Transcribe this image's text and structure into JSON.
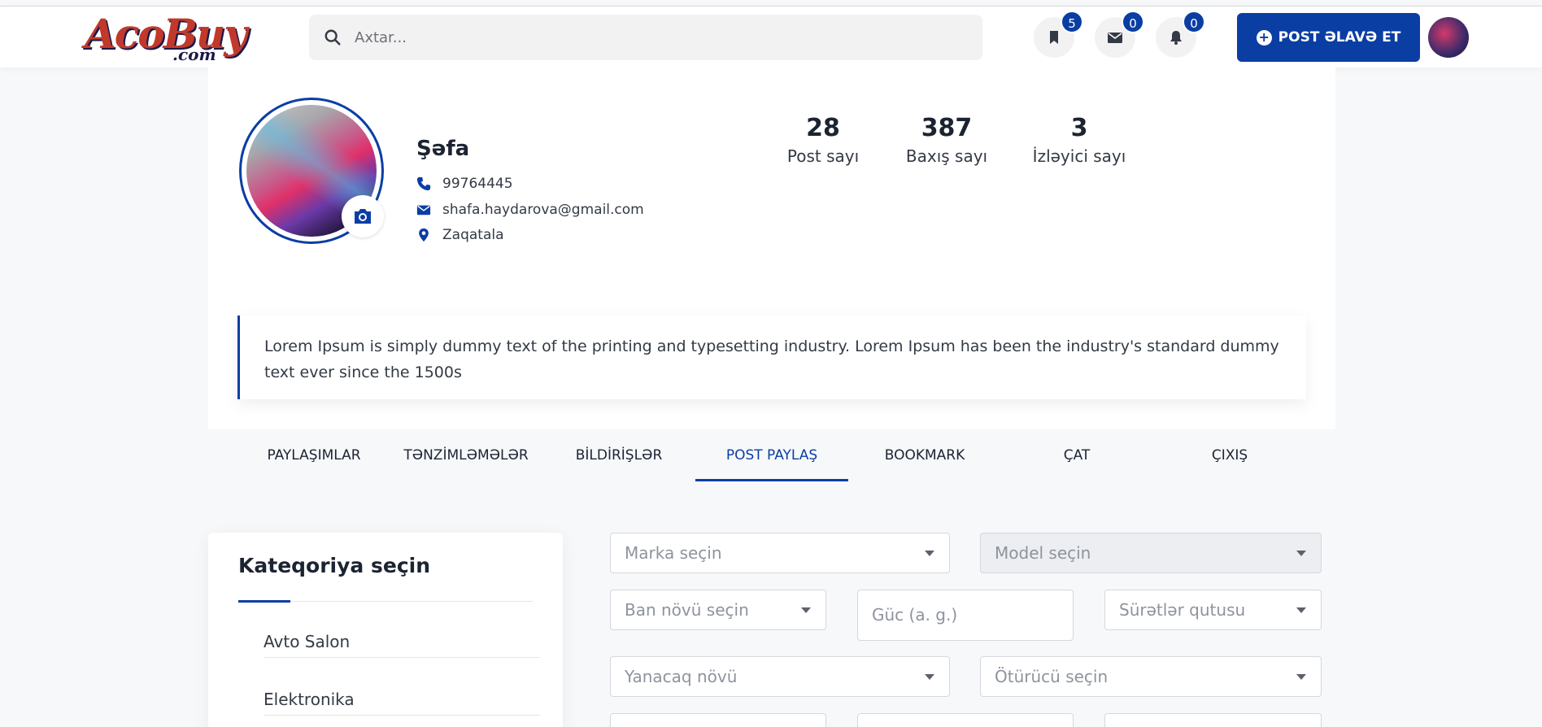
{
  "header": {
    "logo_text": "AcoBuy",
    "logo_domain": ".com",
    "search_placeholder": "Axtar...",
    "bookmark_count": "5",
    "message_count": "0",
    "notification_count": "0",
    "post_button_label": "POST ƏLAVƏ ET"
  },
  "profile": {
    "name": "Şəfa",
    "phone": "99764445",
    "email": "shafa.haydarova@gmail.com",
    "location": "Zaqatala",
    "stats": [
      {
        "value": "28",
        "label": "Post sayı"
      },
      {
        "value": "387",
        "label": "Baxış sayı"
      },
      {
        "value": "3",
        "label": "İzləyici sayı"
      }
    ],
    "bio": "Lorem Ipsum is simply dummy text of the printing and typesetting industry. Lorem Ipsum has been the industry's standard dummy text ever since the 1500s"
  },
  "tabs": [
    {
      "label": "PAYLAŞIMLAR"
    },
    {
      "label": "TƏNZİMLƏMƏLƏR"
    },
    {
      "label": "BİLDİRİŞLƏR"
    },
    {
      "label": "POST PAYLAŞ"
    },
    {
      "label": "BOOKMARK"
    },
    {
      "label": "ÇAT"
    },
    {
      "label": "ÇIXIŞ"
    }
  ],
  "active_tab": "POST PAYLAŞ",
  "categories": {
    "title": "Kateqoriya seçin",
    "items": [
      "Avto Salon",
      "Elektronika"
    ]
  },
  "form": {
    "brand": "Marka seçin",
    "model": "Model seçin",
    "body_type": "Ban növü seçin",
    "power_placeholder": "Güc (a. g.)",
    "gearbox": "Sürətlər qutusu",
    "fuel": "Yanacaq növü",
    "drive": "Ötürücü seçin"
  },
  "colors": {
    "accent": "#0a3ea3",
    "text": "#1c2331",
    "muted": "#8e939d"
  }
}
